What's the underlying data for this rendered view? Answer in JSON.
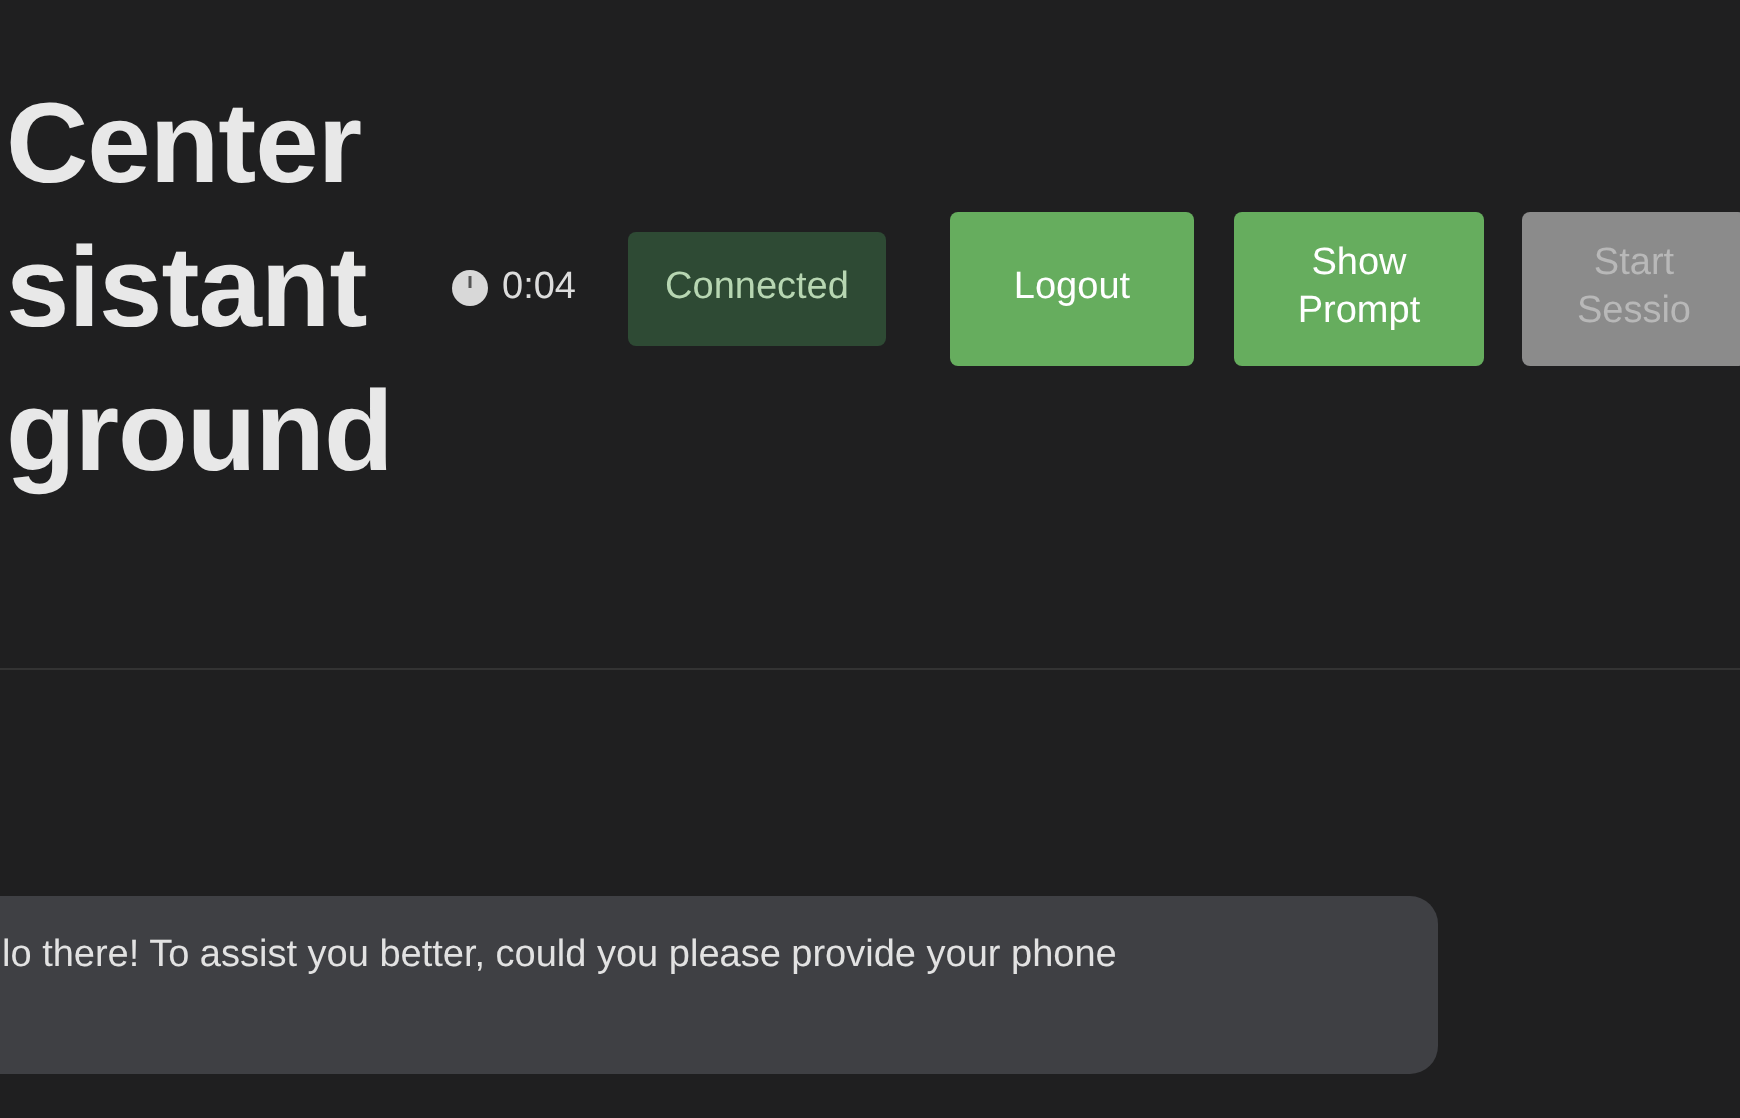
{
  "title": [
    "Center",
    "sistant",
    "ground"
  ],
  "timer": {
    "time": "0:04"
  },
  "status": {
    "label": "Connected"
  },
  "buttons": [
    {
      "label": "Logout",
      "disabled": false
    },
    {
      "label": "Show Prompt",
      "disabled": false
    },
    {
      "label": "Start Sessio",
      "disabled": true
    }
  ],
  "messages": [
    {
      "text": "lo there! To assist you better, could you please provide your phone"
    }
  ]
}
